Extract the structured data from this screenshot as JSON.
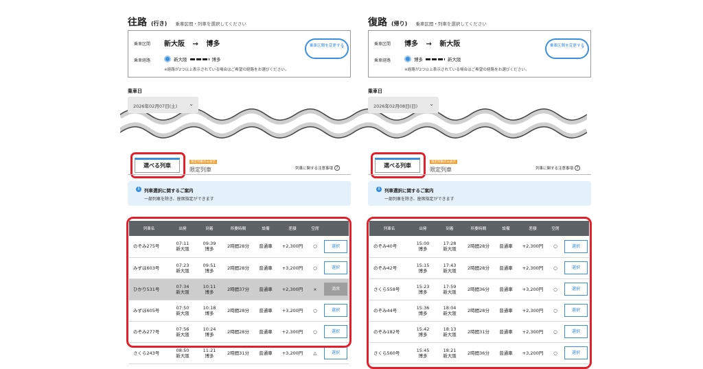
{
  "panels": [
    {
      "title": "往路",
      "subtitle": "(行き)",
      "note": "乗車区間・列車を選択してください",
      "route": {
        "section_label": "乗車区間",
        "from": "新大阪",
        "arrow": "→",
        "to": "博多",
        "via_label": "乗車経路",
        "via_from": "新大阪",
        "via_to": "博多",
        "note": "※経路が2つ以上表示されている場合はご希望の経路をお選びください。",
        "change_button": "乗車区間を変更する"
      },
      "date_label": "乗車日",
      "date_value": "2026年02月07日(土)",
      "tab_selected": "選べる列車",
      "tab_limited_badge": "限定列車のみ表示",
      "tab_limited": "限定列車",
      "notice_link": "列車に関する注意事項",
      "info_title": "列車選択に関するご案内",
      "info_body": "一部列車を除き、座席指定ができます",
      "columns": [
        "列車名",
        "出発",
        "到着",
        "所要時間",
        "設備",
        "差額",
        "空席",
        ""
      ],
      "rows": [
        {
          "name": "のぞみ275号",
          "dep_time": "07:11",
          "dep_sta": "新大阪",
          "arr_time": "09:39",
          "arr_sta": "博多",
          "duration": "2時間28分",
          "car": "普通車",
          "diff": "+2,300円",
          "seat": "○",
          "action": "選択",
          "enabled": true
        },
        {
          "name": "みずほ603号",
          "dep_time": "07:23",
          "dep_sta": "新大阪",
          "arr_time": "09:51",
          "arr_sta": "博多",
          "duration": "2時間28分",
          "car": "普通車",
          "diff": "+3,200円",
          "seat": "○",
          "action": "選択",
          "enabled": true
        },
        {
          "name": "ひかり531号",
          "dep_time": "07:34",
          "dep_sta": "新大阪",
          "arr_time": "10:11",
          "arr_sta": "博多",
          "duration": "2時間37分",
          "car": "普通車",
          "diff": "+2,300円",
          "seat": "×",
          "action": "満席",
          "enabled": false
        },
        {
          "name": "みずほ605号",
          "dep_time": "07:50",
          "dep_sta": "新大阪",
          "arr_time": "10:18",
          "arr_sta": "博多",
          "duration": "2時間28分",
          "car": "普通車",
          "diff": "+3,200円",
          "seat": "○",
          "action": "選択",
          "enabled": true
        },
        {
          "name": "のぞみ277号",
          "dep_time": "07:56",
          "dep_sta": "新大阪",
          "arr_time": "10:24",
          "arr_sta": "博多",
          "duration": "2時間28分",
          "car": "普通車",
          "diff": "+2,300円",
          "seat": "○",
          "action": "選択",
          "enabled": true
        },
        {
          "name": "さくら243号",
          "dep_time": "08:50",
          "dep_sta": "新大阪",
          "arr_time": "11:21",
          "arr_sta": "博多",
          "duration": "2時間31分",
          "car": "普通車",
          "diff": "+3,200円",
          "seat": "△",
          "action": "選択",
          "enabled": true
        }
      ]
    },
    {
      "title": "復路",
      "subtitle": "(帰り)",
      "note": "乗車区間・列車を選択してください",
      "route": {
        "section_label": "乗車区間",
        "from": "博多",
        "arrow": "→",
        "to": "新大阪",
        "via_label": "乗車経路",
        "via_from": "博多",
        "via_to": "新大阪",
        "note": "※経路が2つ以上表示されている場合はご希望の経路をお選びください。",
        "change_button": "乗車区間を変更する"
      },
      "date_label": "乗車日",
      "date_value": "2026年02月08日(日)",
      "tab_selected": "選べる列車",
      "tab_limited_badge": "限定列車のみ表示",
      "tab_limited": "限定列車",
      "notice_link": "列車に関する注意事項",
      "info_title": "列車選択に関するご案内",
      "info_body": "一部列車を除き、座席指定ができます",
      "columns": [
        "列車名",
        "出発",
        "到着",
        "所要時間",
        "設備",
        "差額",
        "空席",
        ""
      ],
      "rows": [
        {
          "name": "のぞみ40号",
          "dep_time": "15:00",
          "dep_sta": "博多",
          "arr_time": "17:28",
          "arr_sta": "新大阪",
          "duration": "2時間28分",
          "car": "普通車",
          "diff": "+2,300円",
          "seat": "○",
          "action": "選択",
          "enabled": true
        },
        {
          "name": "のぞみ42号",
          "dep_time": "15:15",
          "dep_sta": "博多",
          "arr_time": "17:43",
          "arr_sta": "新大阪",
          "duration": "2時間28分",
          "car": "普通車",
          "diff": "+2,300円",
          "seat": "○",
          "action": "選択",
          "enabled": true
        },
        {
          "name": "さくら558号",
          "dep_time": "15:23",
          "dep_sta": "博多",
          "arr_time": "17:59",
          "arr_sta": "新大阪",
          "duration": "2時間36分",
          "car": "普通車",
          "diff": "+3,200円",
          "seat": "○",
          "action": "選択",
          "enabled": true
        },
        {
          "name": "のぞみ44号",
          "dep_time": "15:36",
          "dep_sta": "博多",
          "arr_time": "18:04",
          "arr_sta": "新大阪",
          "duration": "2時間28分",
          "car": "普通車",
          "diff": "+2,300円",
          "seat": "○",
          "action": "選択",
          "enabled": true
        },
        {
          "name": "のぞみ182号",
          "dep_time": "15:42",
          "dep_sta": "博多",
          "arr_time": "18:13",
          "arr_sta": "新大阪",
          "duration": "2時間31分",
          "car": "普通車",
          "diff": "+2,300円",
          "seat": "○",
          "action": "選択",
          "enabled": true
        },
        {
          "name": "さくら560号",
          "dep_time": "15:45",
          "dep_sta": "博多",
          "arr_time": "18:21",
          "arr_sta": "新大阪",
          "duration": "2時間36分",
          "car": "普通車",
          "diff": "+3,200円",
          "seat": "○",
          "action": "選択",
          "enabled": true
        }
      ]
    }
  ],
  "colors": {
    "accent": "#3a8fdc",
    "highlight_ring": "#e0202a",
    "table_header": "#5d6267",
    "info_bg": "#e4f1fb",
    "unavailable_row": "#cdcdcd"
  }
}
